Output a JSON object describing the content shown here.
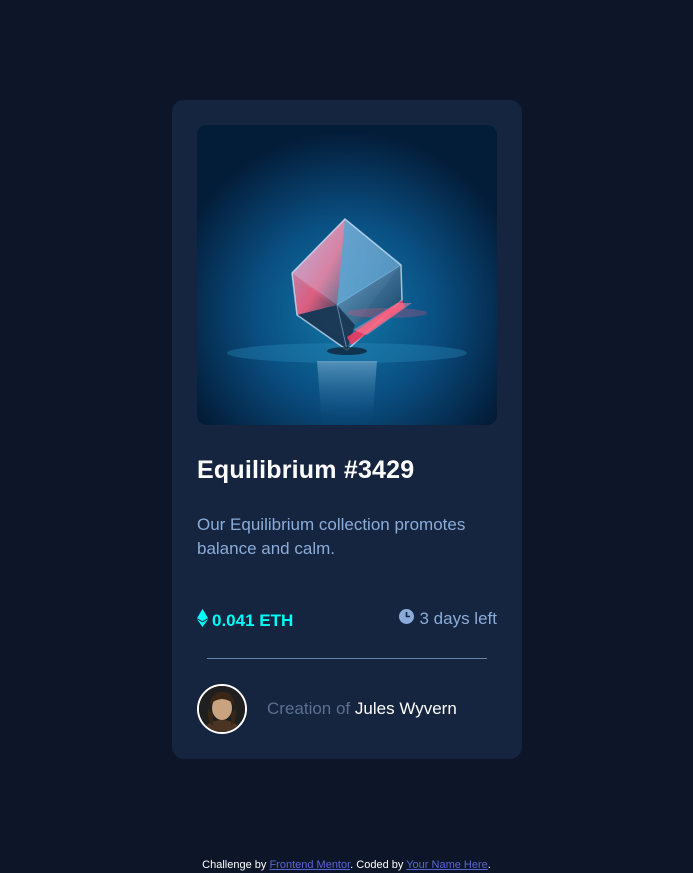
{
  "card": {
    "title": "Equilibrium #3429",
    "description": "Our Equilibrium collection promotes balance and calm.",
    "price": "0.041 ETH",
    "time_left": "3 days left",
    "creation_prefix": "Creation of",
    "creator_name": "Jules Wyvern"
  },
  "footer": {
    "challenge_by": "Challenge by",
    "frontend_mentor": "Frontend Mentor",
    "coded_by": ". Coded by",
    "your_name": "Your Name Here",
    "end": "."
  },
  "colors": {
    "background": "#0d1628",
    "card": "#15243f",
    "accent": "#00fff8",
    "muted": "#8bacd9",
    "link": "#5b66d6"
  },
  "icons": {
    "price": "ethereum-icon",
    "time": "clock-icon"
  }
}
